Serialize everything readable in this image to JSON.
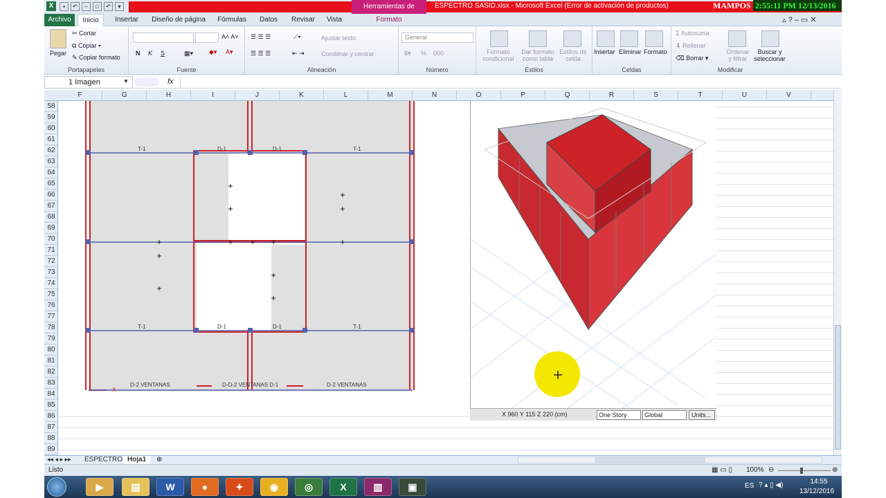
{
  "window": {
    "title": "ESPECTRO SASID.xlsx  -  Microsoft Excel (Error de activación de productos)",
    "image_tools_tab": "Herramientas de imagen",
    "overlay_text": "MAMPOS",
    "clock": "2:55:11 PM 12/13/2016"
  },
  "ribbon_tabs": [
    "Archivo",
    "Inicio",
    "Insertar",
    "Diseño de página",
    "Fórmulas",
    "Datos",
    "Revisar",
    "Vista",
    "Formato"
  ],
  "ribbon": {
    "portapapeles": {
      "label": "Portapapeles",
      "pegar": "Pegar",
      "cortar": "Cortar",
      "copiar": "Copiar",
      "copiar_formato": "Copiar formato"
    },
    "fuente": {
      "label": "Fuente",
      "bold": "N",
      "italic": "K",
      "underline": "S"
    },
    "alineacion": {
      "label": "Alineación",
      "ajustar": "Ajustar texto",
      "combinar": "Combinar y centrar"
    },
    "numero": {
      "label": "Número",
      "format": "General",
      "pct": "%",
      "thousands": "000"
    },
    "estilos": {
      "label": "Estilos",
      "formato_condicional": "Formato condicional",
      "dar_formato": "Dar formato como tabla",
      "estilos_celda": "Estilos de celda"
    },
    "celdas": {
      "label": "Celdas",
      "insertar": "Insertar",
      "eliminar": "Eliminar",
      "formato": "Formato"
    },
    "modificar": {
      "label": "Modificar",
      "autosuma": "Autosuma",
      "rellenar": "Rellenar",
      "borrar": "Borrar",
      "ordenar": "Ordenar y filtrar",
      "buscar": "Buscar y seleccionar"
    }
  },
  "formula_bar": {
    "name_box": "1 Imagen",
    "fx": "fx",
    "value": ""
  },
  "columns": [
    "F",
    "G",
    "H",
    "I",
    "J",
    "K",
    "L",
    "M",
    "N",
    "O",
    "P",
    "Q",
    "R",
    "S",
    "T",
    "U",
    "V"
  ],
  "rows": [
    "58",
    "59",
    "60",
    "61",
    "62",
    "63",
    "64",
    "65",
    "66",
    "67",
    "68",
    "69",
    "70",
    "71",
    "72",
    "73",
    "74",
    "75",
    "76",
    "77",
    "78",
    "79",
    "80",
    "81",
    "82",
    "83",
    "84",
    "85",
    "86",
    "87",
    "88",
    "89"
  ],
  "plan": {
    "labels": {
      "t1": "T-1",
      "d1": "D-1",
      "x": "X",
      "d2v": "D-2 VENTANAS",
      "d2vd1": "D-D-2 VENTANAS D-1"
    }
  },
  "model": {
    "coords": "X 960  Y 115  Z 220  (cm)",
    "story": "One Story",
    "system": "Global",
    "units": "Units..."
  },
  "sheets": [
    "ESPECTRO",
    "Hoja1"
  ],
  "status": {
    "ready": "Listo",
    "zoom": "100%"
  },
  "taskbar": {
    "lang": "ES",
    "time": "14:55",
    "date": "13/12/2016"
  }
}
